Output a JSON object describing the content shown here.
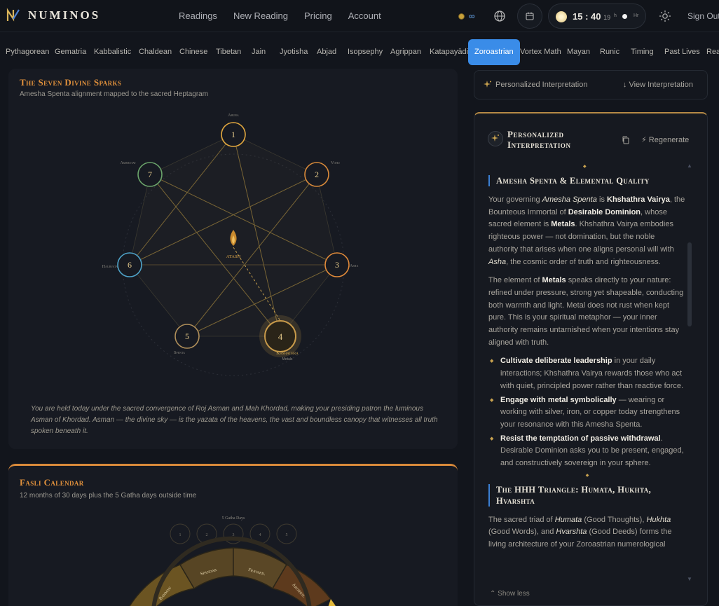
{
  "app": {
    "logo_text": "NUMINOS",
    "nav": [
      "Readings",
      "New Reading",
      "Pricing",
      "Account"
    ],
    "credits": "∞",
    "clock": {
      "hours": "15",
      "minutes": "40",
      "seconds": "19",
      "h_label": "h",
      "hr_label": "Hr"
    },
    "sign_out": "Sign Out"
  },
  "tabs": [
    "Pythagorean",
    "Gematria",
    "Kabbalistic",
    "Chaldean",
    "Chinese",
    "Tibetan",
    "Jain",
    "Jyotisha",
    "Abjad",
    "Isopsephy",
    "Agrippan",
    "Katapayādi",
    "Zoroastrian",
    "Vortex Math",
    "Mayan",
    "Runic",
    "Timing",
    "Past Lives",
    "Rea"
  ],
  "active_tab": "Zoroastrian",
  "sparks": {
    "title": "The Seven Divine Sparks",
    "subtitle": "Amesha Spenta alignment mapped to the sacred Heptagram",
    "center_label": "ATASH",
    "nodes": [
      {
        "num": "1",
        "label": "Ahura",
        "color": "#e4a93f"
      },
      {
        "num": "2",
        "label": "Vohu",
        "color": "#d98a3a"
      },
      {
        "num": "3",
        "label": "Asha",
        "color": "#e08a3a"
      },
      {
        "num": "4",
        "label": "Khshathra",
        "sublabel": "Metals",
        "color": "#c89a4a"
      },
      {
        "num": "5",
        "label": "Spenta",
        "color": "#b08f5a"
      },
      {
        "num": "6",
        "label": "Haurvatat",
        "color": "#4ea3c9"
      },
      {
        "num": "7",
        "label": "Ameretat",
        "color": "#6aa36a"
      }
    ],
    "quote": "You are held today under the sacred convergence of Roj Asman and Mah Khordad, making your presiding patron the luminous Asman of Khordad. Asman — the divine sky — is the yazata of the heavens, the vast and boundless canopy that witnesses all truth spoken beneath it."
  },
  "fasli": {
    "title": "Fasli Calendar",
    "subtitle": "12 months of 30 days plus the 5 Gatha days outside time",
    "gatha_label": "5 Gatha Days",
    "gatha_days": [
      "1",
      "2",
      "3",
      "4",
      "5"
    ],
    "months": [
      "Bahman",
      "Spandar",
      "Fravard.",
      "Ardibeh."
    ]
  },
  "panel": {
    "top_label": "Personalized Interpretation",
    "view_label": "View Interpretation",
    "title": "Personalized Interpretation",
    "regenerate": "Regenerate",
    "section1_title": "Amesha Spenta & Elemental Quality",
    "p1": {
      "a": "Your governing ",
      "b": "Amesha Spenta",
      "c": " is ",
      "d": "Khshathra Vairya",
      "e": ", the Bounteous Immortal of ",
      "f": "Desirable Dominion",
      "g": ", whose sacred element is ",
      "h": "Metals",
      "i": ". Khshathra Vairya embodies righteous power — not domination, but the noble authority that arises when one aligns personal will with ",
      "j": "Asha",
      "k": ", the cosmic order of truth and righteousness."
    },
    "p2": {
      "a": "The element of ",
      "b": "Metals",
      "c": " speaks directly to your nature: refined under pressure, strong yet shapeable, conducting both warmth and light. Metal does not rust when kept pure. This is your spiritual metaphor — your inner authority remains untarnished when your intentions stay aligned with truth."
    },
    "bullets": [
      {
        "bold": "Cultivate deliberate leadership",
        "text": " in your daily interactions; Khshathra Vairya rewards those who act with quiet, principled power rather than reactive force."
      },
      {
        "bold": "Engage with metal symbolically",
        "text": " — wearing or working with silver, iron, or copper today strengthens your resonance with this Amesha Spenta."
      },
      {
        "bold": "Resist the temptation of passive withdrawal",
        "text": ". Desirable Dominion asks you to be present, engaged, and constructively sovereign in your sphere."
      }
    ],
    "section2_title": "The HHH Triangle: Humata, Hukhta, Hvarshta",
    "p3": {
      "a": "The sacred triad of ",
      "b": "Humata",
      "c": " (Good Thoughts), ",
      "d": "Hukhta",
      "e": " (Good Words), and ",
      "f": "Hvarshta",
      "g": " (Good Deeds) forms the living architecture of your Zoroastrian numerological"
    },
    "show_less": "Show less"
  }
}
